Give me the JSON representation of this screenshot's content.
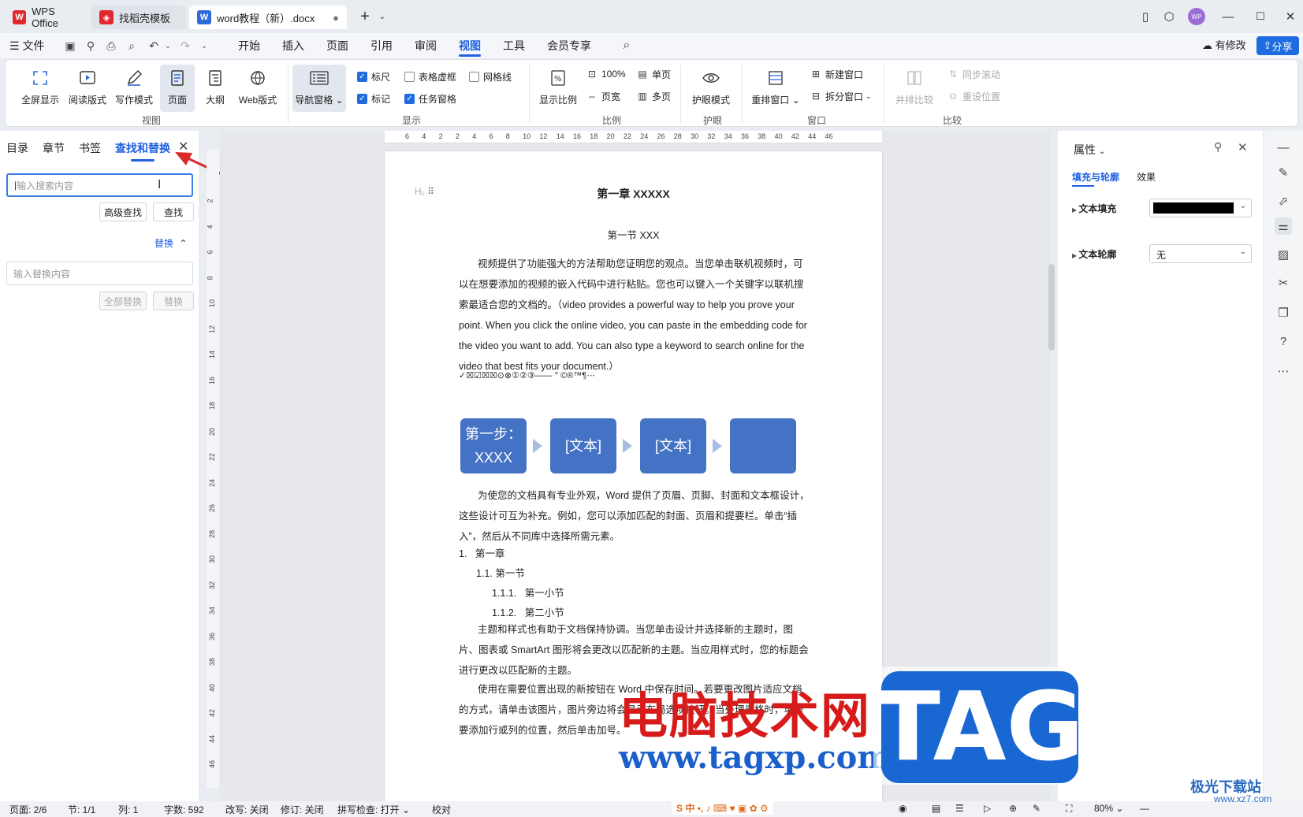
{
  "titlebar": {
    "tabs": [
      {
        "label": "WPS Office",
        "icon": "wps-logo-icon",
        "color": "#e0272d"
      },
      {
        "label": "找稻壳模板",
        "icon": "daoke-icon",
        "color": "#e0272d"
      },
      {
        "label": "word教程（新）.docx",
        "icon": "word-doc-icon",
        "color": "#2f6ad9"
      }
    ],
    "add_tab": "+",
    "avatar": "WP"
  },
  "menubar": {
    "file": "文件",
    "items": [
      "开始",
      "插入",
      "页面",
      "引用",
      "审阅",
      "视图",
      "工具",
      "会员专享"
    ],
    "active": "视图",
    "has_changes": "有修改",
    "share": "分享"
  },
  "ribbon": {
    "view_group": {
      "buttons": [
        "全屏显示",
        "阅读版式",
        "写作模式",
        "页面",
        "大纲",
        "Web版式"
      ],
      "label": "视图"
    },
    "show_group": {
      "nav_pane": "导航窗格",
      "checks": [
        {
          "label": "标尺",
          "checked": true
        },
        {
          "label": "表格虚框",
          "checked": false
        },
        {
          "label": "网格线",
          "checked": false
        },
        {
          "label": "标记",
          "checked": true
        },
        {
          "label": "任务窗格",
          "checked": true
        }
      ],
      "label": "显示"
    },
    "zoom_group": {
      "zoom": "显示比例",
      "hundred": "100%",
      "page_width": "页宽",
      "single": "单页",
      "multi": "多页",
      "label": "比例"
    },
    "eye_group": {
      "eye_mode": "护眼模式",
      "label": "护眼"
    },
    "window_group": {
      "rearrange": "重排窗口",
      "new_window": "新建窗口",
      "split": "拆分窗口",
      "label": "窗口"
    },
    "compare_group": {
      "side_by_side": "并排比较",
      "sync_scroll": "同步滚动",
      "reset_pos": "重设位置",
      "label": "比较"
    }
  },
  "leftpanel": {
    "tabs": [
      "目录",
      "章节",
      "书签",
      "查找和替换"
    ],
    "active_tab": "查找和替换",
    "search_placeholder": "输入搜索内容",
    "advanced_find": "高级查找",
    "find": "查找",
    "replace_toggle": "替换",
    "replace_placeholder": "输入替换内容",
    "replace_all": "全部替换",
    "replace": "替换"
  },
  "hruler_ticks": [
    "6",
    "4",
    "2",
    "2",
    "4",
    "6",
    "8",
    "10",
    "12",
    "14",
    "16",
    "18",
    "20",
    "22",
    "24",
    "26",
    "28",
    "30",
    "32",
    "34",
    "36",
    "38",
    "40",
    "42",
    "44",
    "46"
  ],
  "vruler_ticks": [
    "2",
    "4",
    "6",
    "8",
    "10",
    "12",
    "14",
    "16",
    "18",
    "20",
    "22",
    "24",
    "26",
    "28",
    "30",
    "32",
    "34",
    "36",
    "38",
    "40",
    "42",
    "44",
    "46"
  ],
  "document": {
    "heading_marker": "H₁",
    "title": "第一章  XXXXX",
    "subtitle": "第一节 XXX",
    "para1": "视频提供了功能强大的方法帮助您证明您的观点。当您单击联机视频时，可以在想要添加的视频的嵌入代码中进行粘贴。您也可以键入一个关键字以联机搜索最适合您的文档的。（video provides a powerful way to help you prove your point. When you click the online video, you can paste in the embedding code for the video you want to add. You can also type a keyword to search online for the video that best fits your document.）",
    "symbols": "✓☒☑☒☒⊙⊗①②③——    °   ©®™¶⋯",
    "flow": [
      "第一步：XXXX",
      "[文本]",
      "[文本]",
      ""
    ],
    "para2": "为使您的文档具有专业外观，Word 提供了页眉、页脚、封面和文本框设计，这些设计可互为补充。例如，您可以添加匹配的封面、页眉和提要栏。单击“插入”，然后从不同库中选择所需元素。",
    "list": [
      {
        "num": "1.",
        "text": "第一章"
      },
      {
        "num": "1.1.",
        "text": "第一节"
      },
      {
        "num": "1.1.1.",
        "text": "第一小节"
      },
      {
        "num": "1.1.2.",
        "text": "第二小节"
      }
    ],
    "para3": "主题和样式也有助于文档保持协调。当您单击设计并选择新的主题时，图片、图表或 SmartArt 图形将会更改以匹配新的主题。当应用样式时，您的标题会进行更改以匹配新的主题。",
    "para4": "使用在需要位置出现的新按钮在 Word 中保存时间。若要更改图片适应文档的方式，请单击该图片，图片旁边将会显示布局选项按钮。当处理表格时，单击要添加行或列的位置，然后单击加号。"
  },
  "rightpanel": {
    "title": "属性",
    "tabs": [
      "填充与轮廓",
      "效果"
    ],
    "active_tab": "填充与轮廓",
    "text_fill": "文本填充",
    "text_fill_color": "#000000",
    "text_outline": "文本轮廓",
    "text_outline_value": "无"
  },
  "statusbar": {
    "page": "页面: 2/6",
    "section": "节: 1/1",
    "column": "列: 1",
    "words": "字数: 592",
    "revise": "改写: 关闭",
    "track": "修订: 关闭",
    "spell": "拼写检查: 打开",
    "proof": "校对",
    "zoom": "80%"
  },
  "watermark": {
    "site_name": "电脑技术网",
    "site_url": "www.tagxp.com",
    "tag": "TAG",
    "xz_name": "极光下载站",
    "xz_url": "www.xz7.com"
  }
}
